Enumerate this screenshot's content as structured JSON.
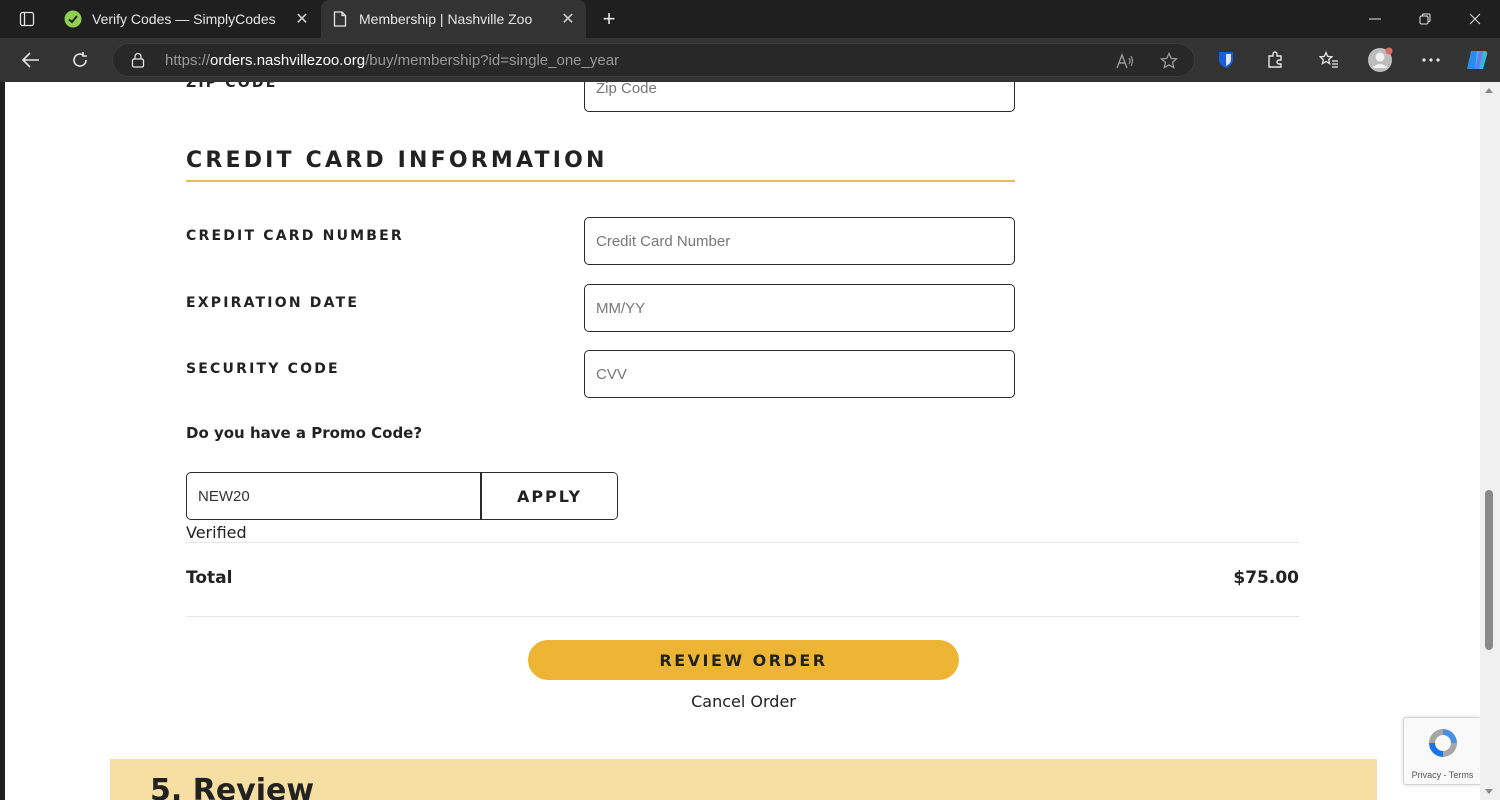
{
  "browser": {
    "tabs": [
      {
        "title": "Verify Codes — SimplyCodes",
        "favicon": "simplycodes-icon",
        "active": false
      },
      {
        "title": "Membership | Nashville Zoo",
        "favicon": "page-icon",
        "active": true
      }
    ],
    "url_prefix": "https://",
    "url_host": "orders.nashvillezoo.org",
    "url_path": "/buy/membership?id=single_one_year"
  },
  "form": {
    "zip_label": "ZIP CODE",
    "zip_placeholder": "Zip Code",
    "section_title": "CREDIT CARD INFORMATION",
    "card_number_label": "CREDIT CARD NUMBER",
    "card_number_placeholder": "Credit Card Number",
    "expiration_label": "EXPIRATION DATE",
    "expiration_placeholder": "MM/YY",
    "security_label": "SECURITY CODE",
    "security_placeholder": "CVV",
    "promo_question": "Do you have a Promo Code?",
    "promo_value": "NEW20",
    "apply_label": "APPLY",
    "promo_status": "Verified"
  },
  "summary": {
    "total_label": "Total",
    "total_value": "$75.00"
  },
  "actions": {
    "review_label": "REVIEW ORDER",
    "cancel_label": "Cancel Order"
  },
  "next_section": {
    "title": "5. Review"
  },
  "recaptcha": {
    "terms": "Privacy - Terms"
  },
  "colors": {
    "accent": "#eeb534",
    "section_rule": "#e9bf4c",
    "review_band": "#f7dfa4"
  }
}
